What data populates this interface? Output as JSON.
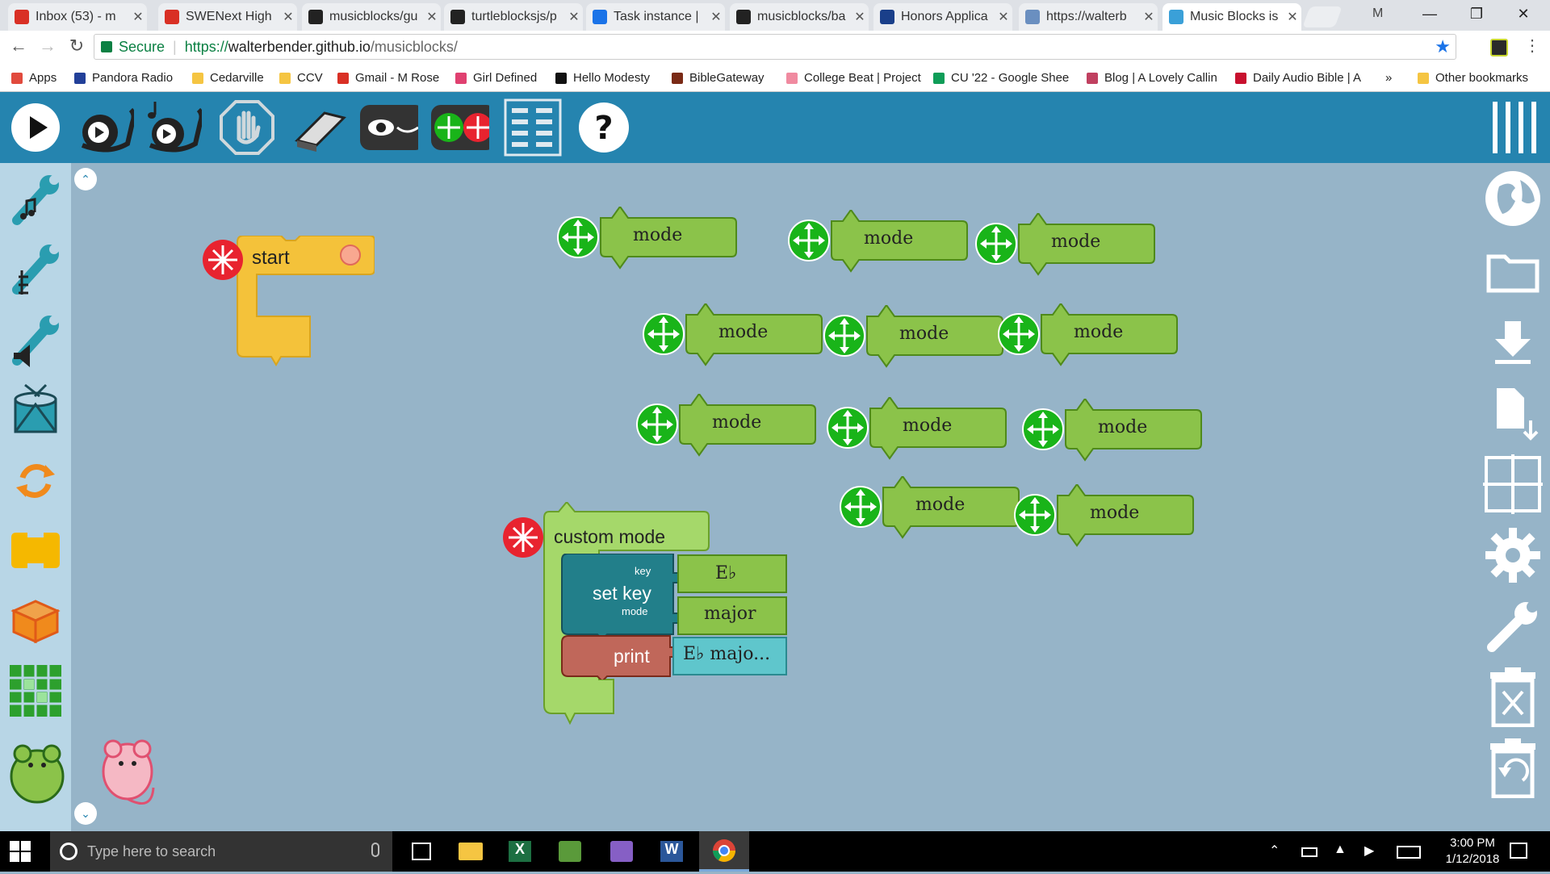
{
  "tabs": [
    {
      "title": "Inbox (53) - m",
      "favicon": "gmail-icon",
      "color": "#d93025"
    },
    {
      "title": "SWENext High",
      "favicon": "gmail-icon",
      "color": "#d93025"
    },
    {
      "title": "musicblocks/gu",
      "favicon": "github-icon",
      "color": "#222"
    },
    {
      "title": "turtleblocksjs/p",
      "favicon": "github-icon",
      "color": "#222"
    },
    {
      "title": "Task instance |",
      "favicon": "gear-icon",
      "color": "#1a73e8"
    },
    {
      "title": "musicblocks/ba",
      "favicon": "github-icon",
      "color": "#222"
    },
    {
      "title": "Honors Applica",
      "favicon": "document-icon",
      "color": "#1a3f8a"
    },
    {
      "title": "https://walterb",
      "favicon": "avatar-icon",
      "color": "#6a8fc0"
    },
    {
      "title": "Music Blocks is",
      "favicon": "music-blocks-icon",
      "color": "#3aa0d8"
    }
  ],
  "window": {
    "profile": "M"
  },
  "address": {
    "secure": "Secure",
    "url_scheme": "https://",
    "url_host": "walterbender.github.io",
    "url_path": "/musicblocks/"
  },
  "bookmarks": [
    {
      "label": "Apps",
      "icon": "apps-icon",
      "color": "#e14a3d"
    },
    {
      "label": "Pandora Radio",
      "icon": "pandora-icon",
      "color": "#224099"
    },
    {
      "label": "Cedarville",
      "icon": "folder-icon",
      "color": "#f5c542"
    },
    {
      "label": "CCV",
      "icon": "folder-icon",
      "color": "#f5c542"
    },
    {
      "label": "Gmail - M Rose",
      "icon": "gmail-icon",
      "color": "#d93025"
    },
    {
      "label": "Girl Defined",
      "icon": "lips-icon",
      "color": "#e04070"
    },
    {
      "label": "Hello Modesty",
      "icon": "heart-icon",
      "color": "#111"
    },
    {
      "label": "BibleGateway",
      "icon": "bible-icon",
      "color": "#7a2a16"
    },
    {
      "label": "College Beat | Project",
      "icon": "heart-icon",
      "color": "#f08aa0"
    },
    {
      "label": "CU '22 - Google Shee",
      "icon": "sheets-icon",
      "color": "#0f9d58"
    },
    {
      "label": "Blog | A Lovely Callin",
      "icon": "blog-icon",
      "color": "#c04060"
    },
    {
      "label": "Daily Audio Bible | A",
      "icon": "dab-icon",
      "color": "#c8102e"
    }
  ],
  "bookmarks_more": "»",
  "other_bookmarks": "Other bookmarks",
  "blocks": {
    "start": {
      "label": "start"
    },
    "mode_label": "mode",
    "custom": {
      "label": "custom mode",
      "setkey": "set key",
      "key_arg": "key",
      "mode_arg": "mode",
      "key_value": "E♭",
      "mode_value": "major",
      "print": "print",
      "print_value": "E♭ majo..."
    }
  },
  "taskbar": {
    "search_placeholder": "Type here to search",
    "time": "3:00 PM",
    "date": "1/12/2018"
  },
  "colors": {
    "mb_toolbar": "#2584af",
    "canvas": "#96b4c8",
    "palette": "#b8d6e6",
    "mode_block": "#8bc34a",
    "start_block": "#f4c23a",
    "setkey_block": "#227f8a",
    "print_block": "#c0675a",
    "custom_block": "#a5d86a"
  }
}
